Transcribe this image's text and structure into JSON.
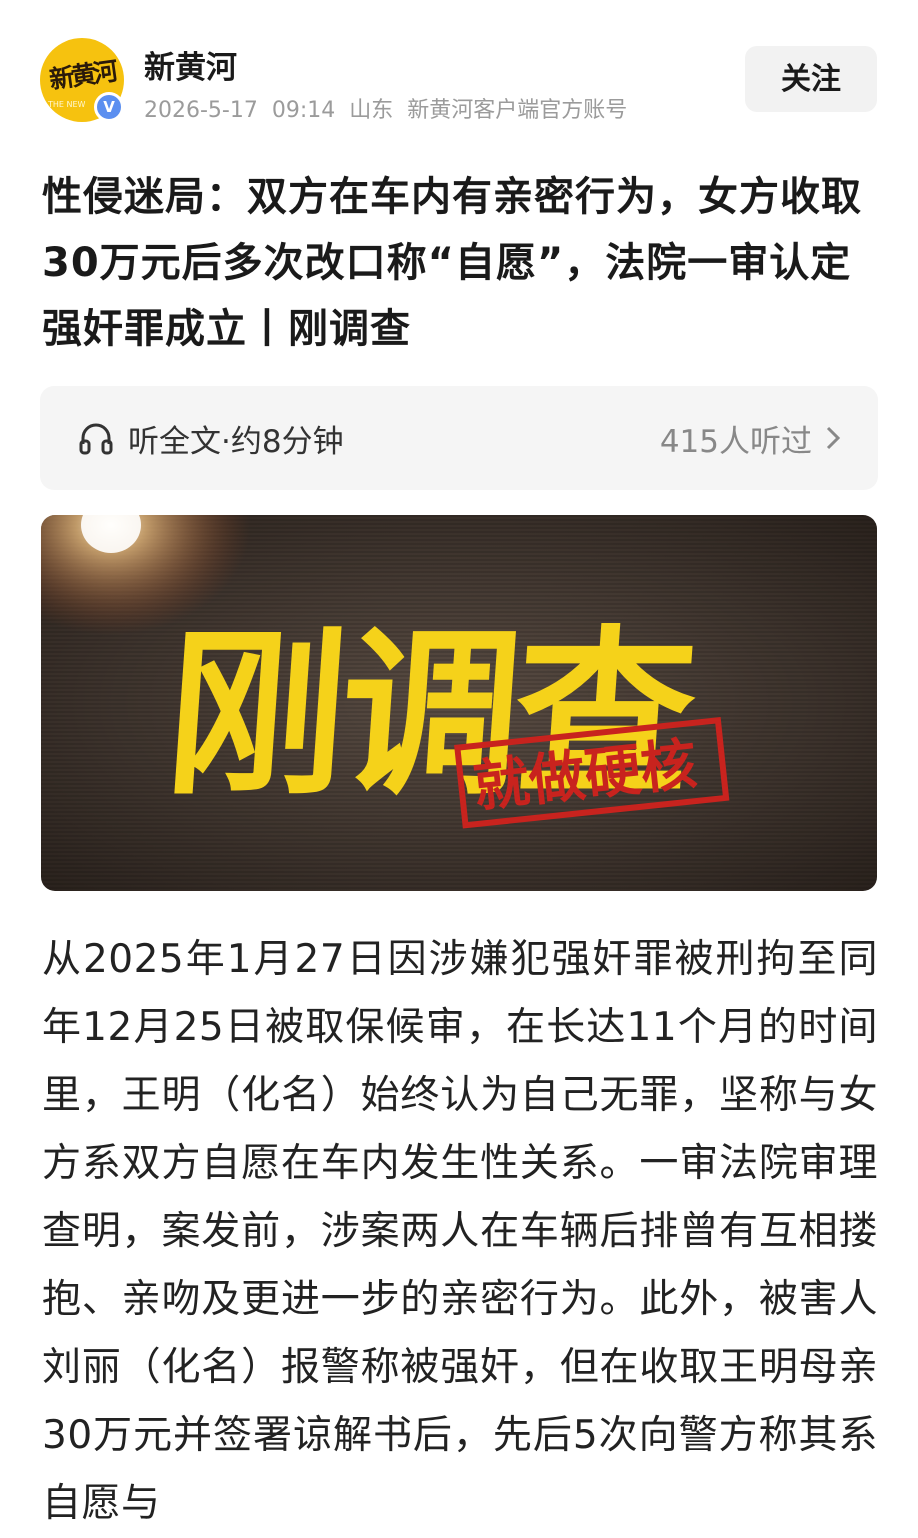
{
  "header": {
    "avatar": {
      "logo_text": "新黄河",
      "logo_sub": "THE NEW"
    },
    "verified_badge": "V",
    "account_name": "新黄河",
    "date": "2026-5-17",
    "time": "09:14",
    "location": "山东",
    "account_description": "新黄河客户端官方账号",
    "follow_label": "关注"
  },
  "article": {
    "title": "性侵迷局：双方在车内有亲密行为，女方收取30万元后多次改口称“自愿”，法院一审认定强奸罪成立丨刚调查",
    "listen": {
      "icon": "headphone-icon",
      "label": "听全文·约8分钟",
      "count": "415人听过",
      "chevron": "chevron-right-icon"
    },
    "banner": {
      "headline": "刚调查",
      "stamp": "就做硬核"
    },
    "body": "从2025年1月27日因涉嫌犯强奸罪被刑拘至同年12月25日被取保候审，在长达11个月的时间里，王明（化名）始终认为自己无罪，坚称与女方系双方自愿在车内发生性关系。一审法院审理查明，案发前，涉案两人在车辆后排曾有互相搂抱、亲吻及更进一步的亲密行为。此外，被害人刘丽（化名）报警称被强奸，但在收取王明母亲30万元并签署谅解书后，先后5次向警方称其系自愿与"
  },
  "colors": {
    "avatar_bg": "#f6c20f",
    "verified": "#5b8ff0",
    "banner_text": "#f5d21a",
    "stamp": "#c8231e",
    "muted": "#9b9b9b"
  }
}
